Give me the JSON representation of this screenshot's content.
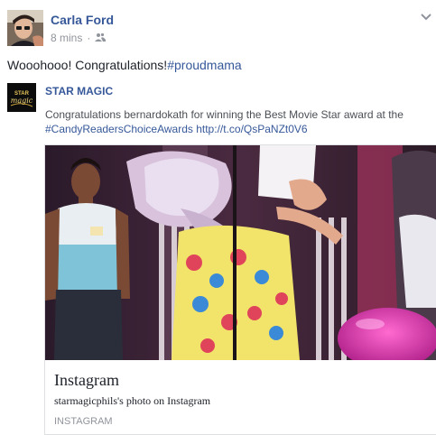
{
  "post": {
    "author": "Carla Ford",
    "time": "8 mins",
    "separator": "·",
    "message": "Wooohooo! Congratulations!",
    "hashtag": "#proudmama"
  },
  "shared": {
    "page_name": "STAR MAGIC",
    "logo_text": "STAR magic",
    "description": "Congratulations bernardokath for winning the Best Movie Star award at the",
    "hashtag": "#CandyReadersChoiceAwards",
    "link": "http://t.co/QsPaNZt0V6"
  },
  "card": {
    "title": "Instagram",
    "description": "starmagicphils's photo on Instagram",
    "source": "INSTAGRAM"
  },
  "icons": {
    "privacy": "friends-icon",
    "menu": "chevron-down-icon"
  },
  "colors": {
    "link": "#365899",
    "meta": "#90949c"
  }
}
